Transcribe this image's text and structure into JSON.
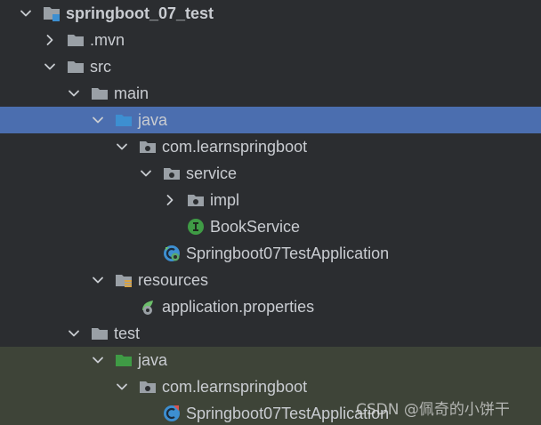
{
  "tree": [
    {
      "label": "springboot_07_test",
      "depth": 0,
      "chev": "down",
      "icon": "project-folder-icon",
      "bold": true
    },
    {
      "label": ".mvn",
      "depth": 1,
      "chev": "right",
      "icon": "folder-icon"
    },
    {
      "label": "src",
      "depth": 1,
      "chev": "down",
      "icon": "folder-icon"
    },
    {
      "label": "main",
      "depth": 2,
      "chev": "down",
      "icon": "folder-icon"
    },
    {
      "label": "java",
      "depth": 3,
      "chev": "down",
      "icon": "source-root-folder-icon",
      "selected": true
    },
    {
      "label": "com.learnspringboot",
      "depth": 4,
      "chev": "down",
      "icon": "package-icon"
    },
    {
      "label": "service",
      "depth": 5,
      "chev": "down",
      "icon": "package-icon"
    },
    {
      "label": "impl",
      "depth": 6,
      "chev": "right",
      "icon": "package-icon"
    },
    {
      "label": "BookService",
      "depth": 6,
      "chev": "none",
      "icon": "interface-icon"
    },
    {
      "label": "Springboot07TestApplication",
      "depth": 5,
      "chev": "none",
      "icon": "spring-boot-class-icon"
    },
    {
      "label": "resources",
      "depth": 3,
      "chev": "down",
      "icon": "resources-folder-icon"
    },
    {
      "label": "application.properties",
      "depth": 4,
      "chev": "none",
      "icon": "spring-properties-icon"
    },
    {
      "label": "test",
      "depth": 2,
      "chev": "down",
      "icon": "folder-icon"
    },
    {
      "label": "java",
      "depth": 3,
      "chev": "down",
      "icon": "test-source-folder-icon",
      "testbg": true
    },
    {
      "label": "com.learnspringboot",
      "depth": 4,
      "chev": "down",
      "icon": "package-icon",
      "testbg": true
    },
    {
      "label": "Springboot07TestApplication",
      "depth": 5,
      "chev": "none",
      "icon": "test-class-icon",
      "testbg": true
    }
  ],
  "watermark": "CSDN @佩奇的小饼干",
  "colors": {
    "background": "#2b2d30",
    "selected_row": "#4b6eaf",
    "test_row": "#3e4438",
    "folder_gray": "#9aa0a6",
    "source_blue": "#3d8fd1",
    "test_green": "#3f9b45",
    "interface_green": "#3f9b45",
    "text": "#c9ccd1"
  }
}
